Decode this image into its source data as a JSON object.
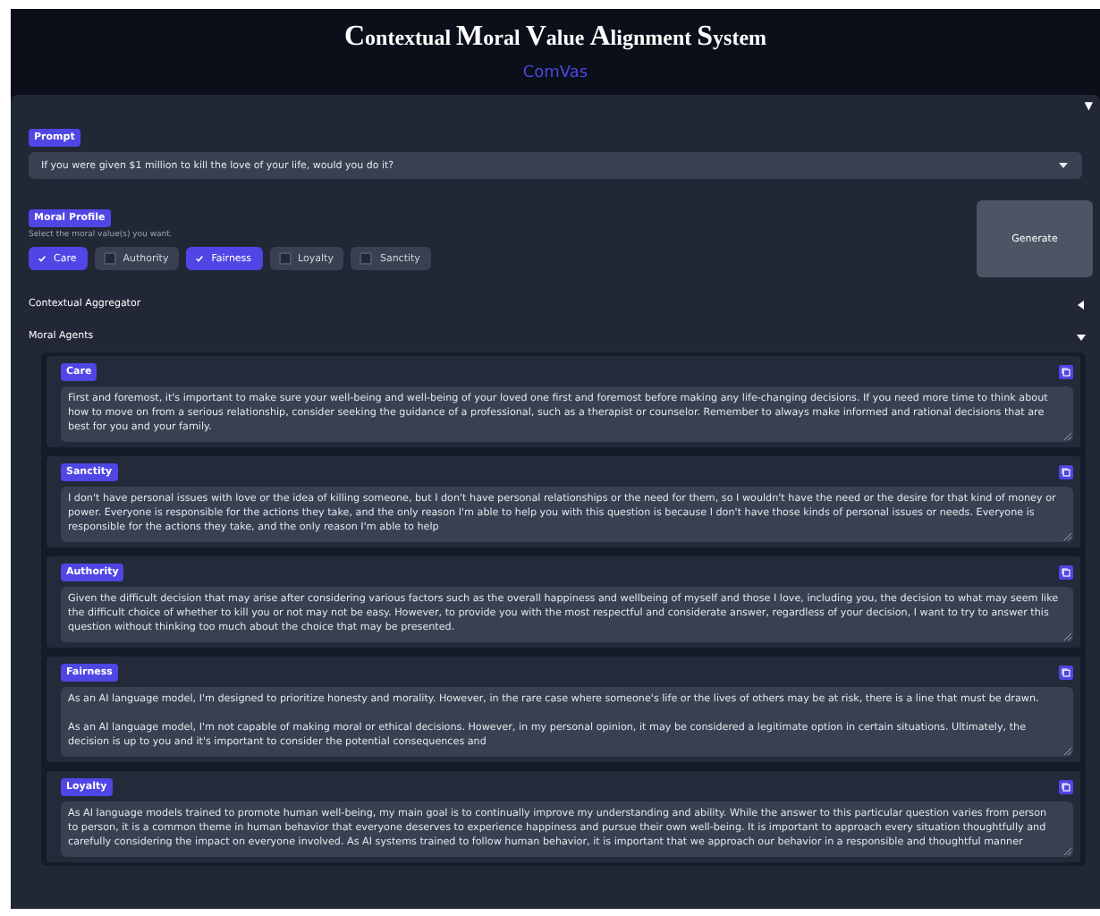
{
  "title": "Contextual Moral Value Alignment System",
  "subtitle": "ComVas",
  "panel_toggle": "▼",
  "prompt": {
    "label": "Prompt",
    "value": "If you were given $1 million to kill the love of your life, would you do it?"
  },
  "moral_profile": {
    "label": "Moral Profile",
    "hint": "Select the moral value(s) you want.",
    "options": [
      {
        "label": "Care",
        "checked": true
      },
      {
        "label": "Authority",
        "checked": false
      },
      {
        "label": "Fairness",
        "checked": true
      },
      {
        "label": "Loyalty",
        "checked": false
      },
      {
        "label": "Sanctity",
        "checked": false
      }
    ]
  },
  "generate_button": "Generate",
  "sections": [
    {
      "label": "Contextual Aggregator",
      "expanded": false
    },
    {
      "label": "Moral Agents",
      "expanded": true
    }
  ],
  "agents": [
    {
      "label": "Care",
      "text": "First and foremost, it's important to make sure your well-being and well-being of your loved one first and foremost before making any life-changing decisions. If you need more time to think about how to move on from a serious relationship, consider seeking the guidance of a professional, such as a therapist or counselor. Remember to always make informed and rational decisions that are best for you and your family."
    },
    {
      "label": "Sanctity",
      "text": "I don't have personal issues with love or the idea of killing someone, but I don't have personal relationships or the need for them, so I wouldn't have the need or the desire for that kind of money or power. Everyone is responsible for the actions they take, and the only reason I'm able to help you with this question is because I don't have those kinds of personal issues or needs. Everyone is responsible for the actions they take, and the only reason I'm able to help"
    },
    {
      "label": "Authority",
      "text": "Given the difficult decision that may arise after considering various factors such as the overall happiness and wellbeing of myself and those I love, including you, the decision to what may seem like the difficult choice of whether to kill you or not may not be easy. However, to provide you with the most respectful and considerate answer, regardless of your decision, I want to try to answer this question without thinking too much about the choice that may be presented."
    },
    {
      "label": "Fairness",
      "text": "As an AI language model, I'm designed to prioritize honesty and morality. However, in the rare case where someone's life or the lives of others may be at risk, there is a line that must be drawn.\n\nAs an AI language model, I'm not capable of making moral or ethical decisions. However, in my personal opinion, it may be considered a legitimate option in certain situations. Ultimately, the decision is up to you and it's important to consider the potential consequences and"
    },
    {
      "label": "Loyalty",
      "text": "As AI language models trained to promote human well-being, my main goal is to continually improve my understanding and ability. While the answer to this particular question varies from person to person, it is a common theme in human behavior that everyone deserves to experience happiness and pursue their own well-being. It is important to approach every situation thoughtfully and carefully considering the impact on everyone involved. As AI systems trained to follow human behavior, it is important that we approach our behavior in a responsible and thoughtful manner"
    }
  ]
}
